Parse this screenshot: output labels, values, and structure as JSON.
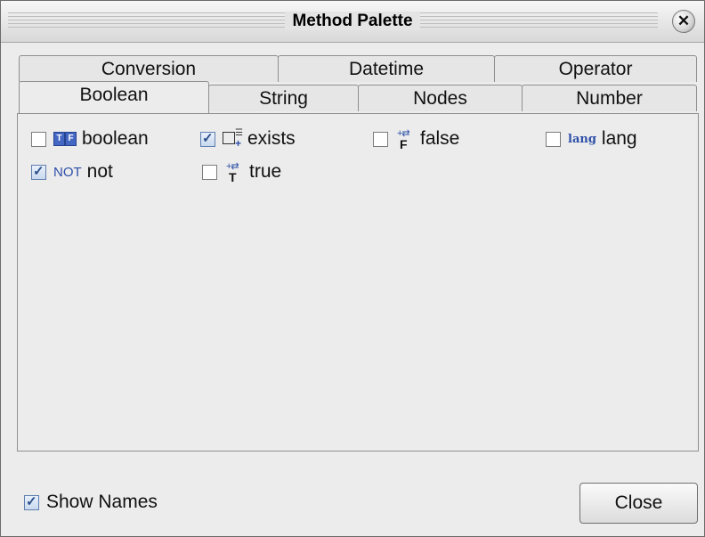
{
  "window": {
    "title": "Method Palette"
  },
  "tabs_back": [
    {
      "label": "Conversion"
    },
    {
      "label": "Datetime"
    },
    {
      "label": "Operator"
    }
  ],
  "tabs_front": [
    {
      "label": "Boolean",
      "active": true
    },
    {
      "label": "String"
    },
    {
      "label": "Nodes"
    },
    {
      "label": "Number"
    }
  ],
  "methods": [
    {
      "label": "boolean",
      "checked": false,
      "icon": "tf-icon"
    },
    {
      "label": "exists",
      "checked": true,
      "icon": "exists-icon"
    },
    {
      "label": "false",
      "checked": false,
      "icon": "false-icon",
      "icon_letter": "F"
    },
    {
      "label": "lang",
      "checked": false,
      "icon": "lang-icon",
      "icon_text": "lang"
    },
    {
      "label": "not",
      "checked": true,
      "icon": "not-icon",
      "icon_text": "NOT"
    },
    {
      "label": "true",
      "checked": false,
      "icon": "true-icon",
      "icon_letter": "T"
    }
  ],
  "footer": {
    "show_names_label": "Show Names",
    "show_names_checked": true,
    "close_label": "Close"
  },
  "colors": {
    "accent": "#2d4fa8",
    "window_bg": "#ececec"
  }
}
